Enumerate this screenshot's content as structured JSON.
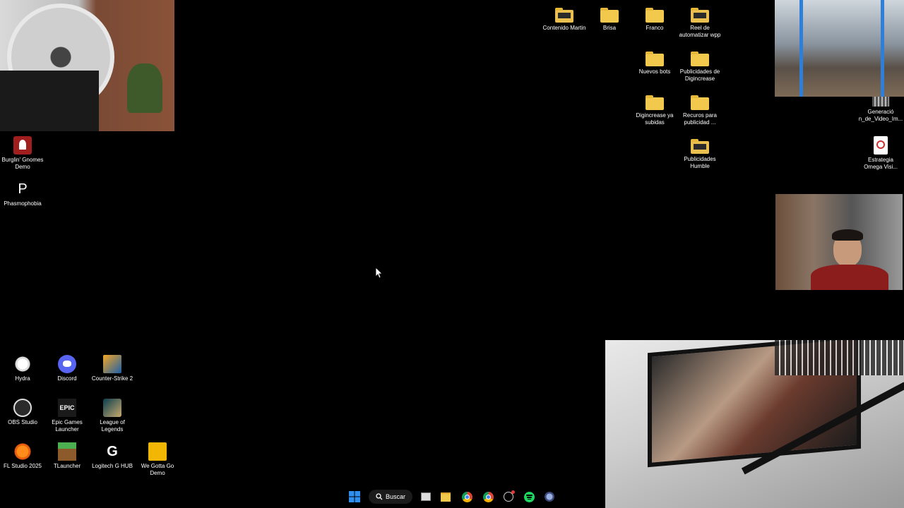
{
  "desktop": {
    "left_icons": [
      {
        "label": "Burglin' Gnomes Demo",
        "icon": "burglin-gnomes-icon"
      },
      {
        "label": "Phasmophobia",
        "icon": "phasmophobia-icon"
      }
    ],
    "bottom_icons": [
      {
        "label": "Hydra",
        "icon": "hydra-icon"
      },
      {
        "label": "Discord",
        "icon": "discord-icon"
      },
      {
        "label": "Counter-Strike 2",
        "icon": "counter-strike-icon"
      },
      {
        "label": "OBS Studio",
        "icon": "obs-icon"
      },
      {
        "label": "Epic Games Launcher",
        "icon": "epic-games-icon"
      },
      {
        "label": "League of Legends",
        "icon": "league-icon"
      },
      {
        "label": "FL Studio 2025",
        "icon": "fl-studio-icon"
      },
      {
        "label": "TLauncher",
        "icon": "tlauncher-icon"
      },
      {
        "label": "Logitech G HUB",
        "icon": "logitech-icon"
      },
      {
        "label": "We Gotta Go Demo",
        "icon": "we-gotta-go-icon"
      }
    ],
    "right_icons": [
      {
        "label": "Contenido Martin",
        "icon": "folder-icon"
      },
      {
        "label": "Brisa",
        "icon": "folder-icon"
      },
      {
        "label": "Franco",
        "icon": "folder-icon"
      },
      {
        "label": "Reel de automatizar wpp",
        "icon": "folder-icon"
      },
      {
        "label": "Nuevos bots",
        "icon": "folder-icon"
      },
      {
        "label": "Publicidades de Digincrease",
        "icon": "folder-icon"
      },
      {
        "label": "Digincrease ya subidas",
        "icon": "folder-icon"
      },
      {
        "label": "Recuros para publicidad ...",
        "icon": "folder-icon"
      },
      {
        "label": "Publicidades Humble",
        "icon": "folder-icon"
      },
      {
        "label": "Generació n_de_Video_Im...",
        "icon": "video-file-icon"
      },
      {
        "label": "Estrategia Omega Visi...",
        "icon": "pdf-icon"
      }
    ]
  },
  "taskbar": {
    "search_label": "Buscar",
    "apps": [
      "windows-start-icon",
      "task-view-icon",
      "file-explorer-icon",
      "chrome-icon",
      "chrome-profile-icon",
      "steam-icon",
      "spotify-icon",
      "app-icon"
    ]
  },
  "colors": {
    "folder": "#f2c94c",
    "desktop_bg": "#000000",
    "start_blue": "#2f8ff0",
    "spotify_green": "#1ed760"
  }
}
